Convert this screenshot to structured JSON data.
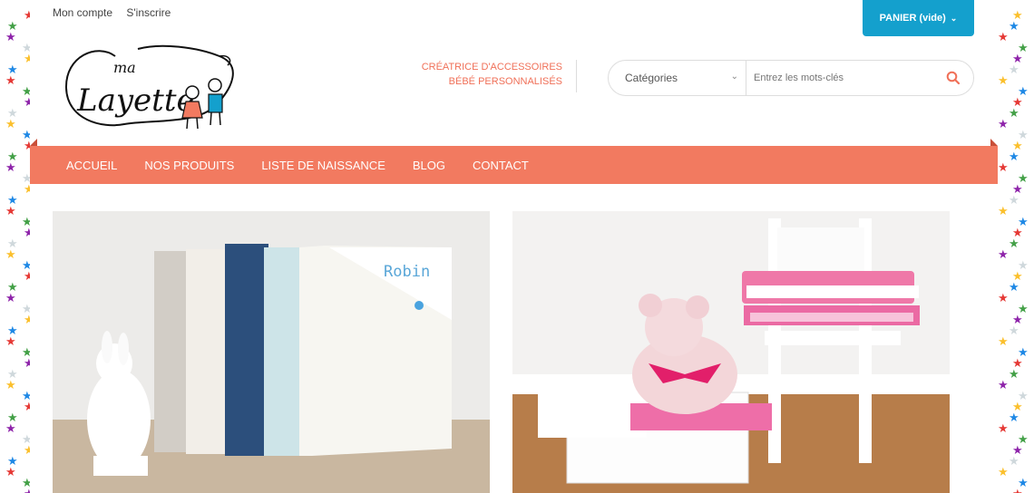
{
  "header": {
    "account_link": "Mon compte",
    "signup_link": "S'inscrire",
    "cart_label": "PANIER (vide)"
  },
  "logo": {
    "word_small": "ma",
    "word_big": "Layette"
  },
  "tagline": {
    "line1": "CRÉATRICE D'ACCESSOIRES",
    "line2": "BÉBÉ PERSONNALISÉS"
  },
  "search": {
    "category_selected": "Catégories",
    "placeholder": "Entrez les mots-clés"
  },
  "nav": {
    "items": [
      "ACCUEIL",
      "NOS PRODUITS",
      "LISTE DE NAISSANCE",
      "BLOG",
      "CONTACT"
    ]
  },
  "photos": {
    "left_embroidery": "Robin"
  },
  "colors": {
    "nav_bg": "#f27a60",
    "accent_blue": "#14a0cd",
    "tagline": "#f07058"
  }
}
